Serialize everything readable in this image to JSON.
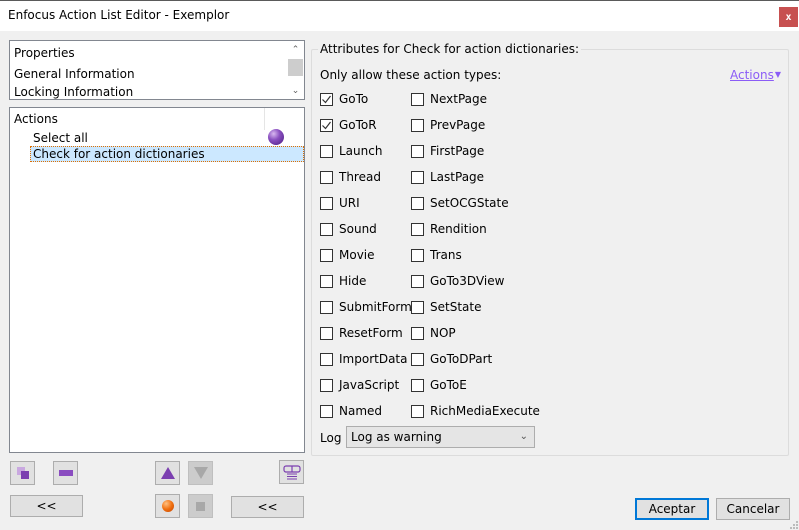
{
  "window": {
    "title": "Enfocus Action List Editor - Exemplor",
    "close_label": "x"
  },
  "properties_list": {
    "items": [
      "Properties",
      "General Information",
      "Locking Information"
    ]
  },
  "actions_list": {
    "header": "Actions",
    "items": [
      {
        "label": "Select all",
        "selected": false
      },
      {
        "label": "Check for action dictionaries",
        "selected": true
      }
    ]
  },
  "attributes": {
    "group_title": "Attributes for Check for action dictionaries:",
    "only_allow_label": "Only allow these action types:",
    "actions_menu_label": "Actions",
    "left_column": [
      {
        "label": "GoTo",
        "checked": true
      },
      {
        "label": "GoToR",
        "checked": true
      },
      {
        "label": "Launch",
        "checked": false
      },
      {
        "label": "Thread",
        "checked": false
      },
      {
        "label": "URI",
        "checked": false
      },
      {
        "label": "Sound",
        "checked": false
      },
      {
        "label": "Movie",
        "checked": false
      },
      {
        "label": "Hide",
        "checked": false
      },
      {
        "label": "SubmitForm",
        "checked": false
      },
      {
        "label": "ResetForm",
        "checked": false
      },
      {
        "label": "ImportData",
        "checked": false
      },
      {
        "label": "JavaScript",
        "checked": false
      },
      {
        "label": "Named",
        "checked": false
      }
    ],
    "right_column": [
      {
        "label": "NextPage",
        "checked": false
      },
      {
        "label": "PrevPage",
        "checked": false
      },
      {
        "label": "FirstPage",
        "checked": false
      },
      {
        "label": "LastPage",
        "checked": false
      },
      {
        "label": "SetOCGState",
        "checked": false
      },
      {
        "label": "Rendition",
        "checked": false
      },
      {
        "label": "Trans",
        "checked": false
      },
      {
        "label": "GoTo3DView",
        "checked": false
      },
      {
        "label": "SetState",
        "checked": false
      },
      {
        "label": "NOP",
        "checked": false
      },
      {
        "label": "GoToDPart",
        "checked": false
      },
      {
        "label": "GoToE",
        "checked": false
      },
      {
        "label": "RichMediaExecute",
        "checked": false
      }
    ],
    "log_label": "Log",
    "log_value": "Log as warning"
  },
  "toolbar": {
    "collapse_left_label": "<<",
    "collapse_right_label": "<<"
  },
  "footer": {
    "ok_label": "Aceptar",
    "cancel_label": "Cancelar"
  },
  "colors": {
    "accent": "#0078d7",
    "close": "#c75050",
    "link": "#8b5cf6",
    "selection": "#cce8ff",
    "icon_purple": "#7b3fb0"
  }
}
